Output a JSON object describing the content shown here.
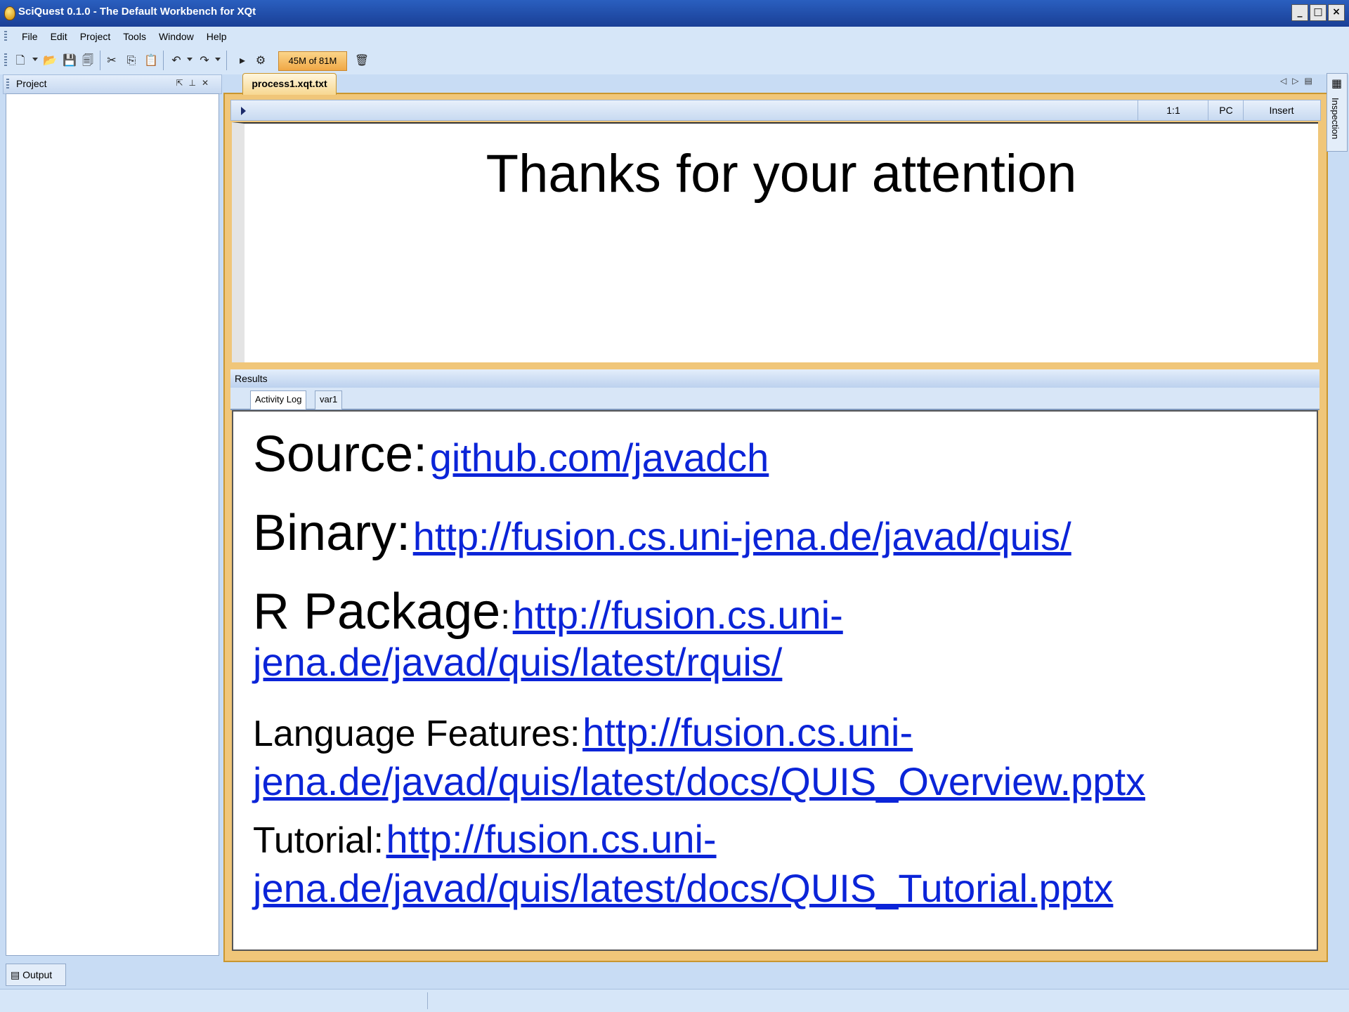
{
  "window": {
    "title": "SciQuest 0.1.0 - The Default Workbench for XQt",
    "controls": [
      "_",
      "□",
      "×"
    ]
  },
  "menu": [
    "File",
    "Edit",
    "Project",
    "Tools",
    "Window",
    "Help"
  ],
  "toolbar": {
    "memory": "45M of 81M"
  },
  "project_panel": {
    "title": "Project"
  },
  "editor_tab": {
    "label": "process1.xqt.txt"
  },
  "editor_status": {
    "position": "1:1",
    "mode": "PC",
    "insert": "Insert"
  },
  "editor": {
    "heading": "Thanks for your attention"
  },
  "results": {
    "title": "Results",
    "tabs": [
      "Activity Log",
      "var1"
    ],
    "source_label": "Source:",
    "source_link": "github.com/javadch",
    "binary_label": "Binary:",
    "binary_link": "http://fusion.cs.uni-jena.de/javad/quis/",
    "rpackage_label": "R Package",
    "rpackage_colon": ":",
    "rpackage_link_1": "http://fusion.cs.uni-",
    "rpackage_link_2": "jena.de/javad/quis/latest/rquis/",
    "lang_label": "Language Features:",
    "lang_link_1": "http://fusion.cs.uni-",
    "lang_link_2": "jena.de/javad/quis/latest/docs/QUIS_Overview.pptx",
    "tutorial_label": "Tutorial:",
    "tutorial_link_1": "http://fusion.cs.uni-",
    "tutorial_link_2": "jena.de/javad/quis/latest/docs/QUIS_Tutorial.pptx"
  },
  "inspection": {
    "label": "Inspection"
  },
  "output_tab": {
    "label": "Output"
  }
}
